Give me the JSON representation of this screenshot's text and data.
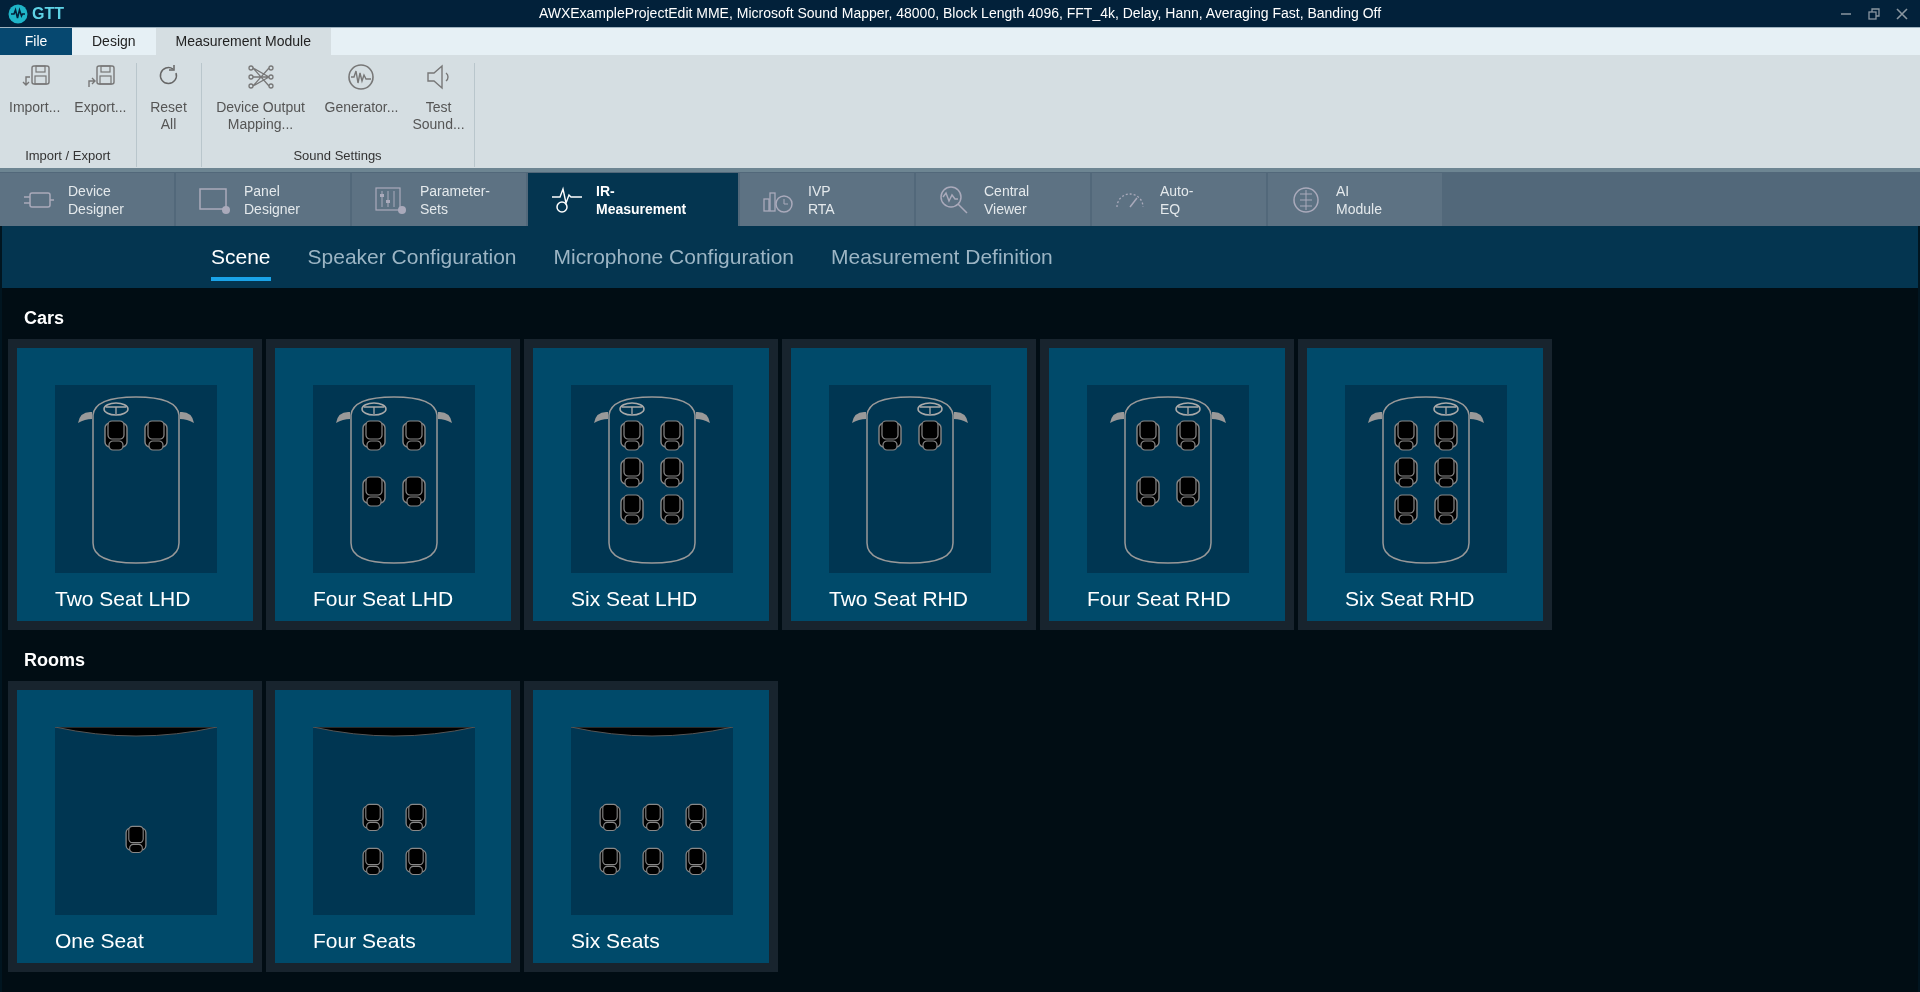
{
  "app": {
    "name": "GTT"
  },
  "window": {
    "title": "AWXExampleProjectEdit MME, Microsoft Sound Mapper, 48000, Block Length 4096, FFT_4k, Delay, Hann, Averaging Fast, Banding Off"
  },
  "file_menu": {
    "label": "File"
  },
  "ribbon_tabs": [
    {
      "label": "Design",
      "selected": false
    },
    {
      "label": "Measurement Module",
      "selected": true
    }
  ],
  "ribbon_groups": [
    {
      "label": "Import / Export",
      "buttons": [
        {
          "label": "Import..."
        },
        {
          "label": "Export..."
        }
      ]
    },
    {
      "buttons": [
        {
          "label": "Reset All"
        }
      ]
    },
    {
      "label": "Sound Settings",
      "buttons": [
        {
          "label": "Device Output Mapping..."
        },
        {
          "label": "Generator..."
        },
        {
          "label": "Test Sound..."
        }
      ]
    }
  ],
  "module_tabs": [
    {
      "label": "Device Designer",
      "selected": false
    },
    {
      "label": "Panel Designer",
      "selected": false
    },
    {
      "label": "Parameter-Sets",
      "selected": false
    },
    {
      "label": "IR-Measurement",
      "selected": true
    },
    {
      "label": "IVP RTA",
      "selected": false
    },
    {
      "label": "Central Viewer",
      "selected": false
    },
    {
      "label": "Auto-EQ",
      "selected": false
    },
    {
      "label": "AI Module",
      "selected": false
    }
  ],
  "sub_tabs": [
    {
      "label": "Scene",
      "selected": true
    },
    {
      "label": "Speaker Configuration",
      "selected": false
    },
    {
      "label": "Microphone Configuration",
      "selected": false
    },
    {
      "label": "Measurement Definition",
      "selected": false
    }
  ],
  "sections": [
    {
      "title": "Cars",
      "tiles": [
        {
          "label": "Two Seat LHD",
          "kind": "car"
        },
        {
          "label": "Four Seat LHD",
          "kind": "car"
        },
        {
          "label": "Six Seat LHD",
          "kind": "car"
        },
        {
          "label": "Two Seat RHD",
          "kind": "car"
        },
        {
          "label": "Four Seat RHD",
          "kind": "car"
        },
        {
          "label": "Six Seat RHD",
          "kind": "car"
        }
      ]
    },
    {
      "title": "Rooms",
      "tiles": [
        {
          "label": "One Seat",
          "kind": "room"
        },
        {
          "label": "Four Seats",
          "kind": "room"
        },
        {
          "label": "Six Seats",
          "kind": "room"
        }
      ]
    }
  ]
}
